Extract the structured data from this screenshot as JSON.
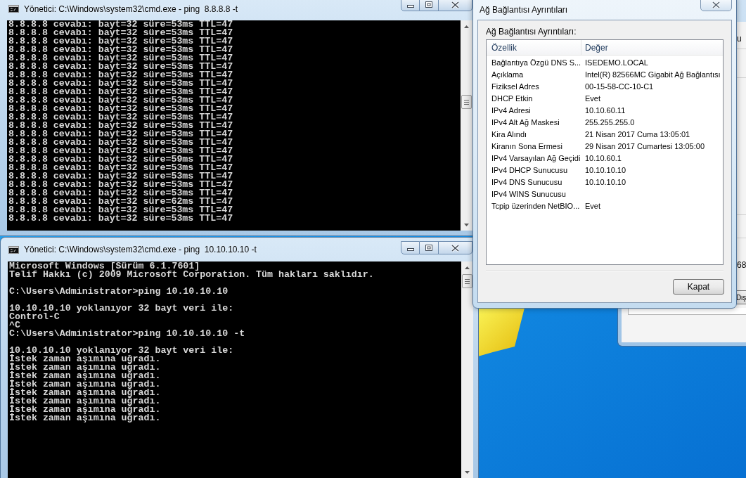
{
  "consoles": [
    {
      "title": "Yönetici: C:\\Windows\\system32\\cmd.exe - ping  8.8.8.8 -t",
      "blocks": [
        [
          "8.8.8.8 cevabı: bayt=32 süre=53ms TTL=47",
          "8.8.8.8 cevabı: bayt=32 süre=53ms TTL=47",
          "8.8.8.8 cevabı: bayt=32 süre=53ms TTL=47",
          "8.8.8.8 cevabı: bayt=32 süre=53ms TTL=47",
          "8.8.8.8 cevabı: bayt=32 süre=53ms TTL=47",
          "8.8.8.8 cevabı: bayt=32 süre=53ms TTL=47",
          "8.8.8.8 cevabı: bayt=32 süre=53ms TTL=47",
          "8.8.8.8 cevabı: bayt=32 süre=53ms TTL=47",
          "8.8.8.8 cevabı: bayt=32 süre=53ms TTL=47",
          "8.8.8.8 cevabı: bayt=32 süre=53ms TTL=47",
          "8.8.8.8 cevabı: bayt=32 süre=53ms TTL=47",
          "8.8.8.8 cevabı: bayt=32 süre=53ms TTL=47",
          "8.8.8.8 cevabı: bayt=32 süre=53ms TTL=47",
          "8.8.8.8 cevabı: bayt=32 süre=53ms TTL=47",
          "8.8.8.8 cevabı: bayt=32 süre=53ms TTL=47",
          "8.8.8.8 cevabı: bayt=32 süre=53ms TTL=47",
          "8.8.8.8 cevabı: bayt=32 süre=59ms TTL=47",
          "8.8.8.8 cevabı: bayt=32 süre=53ms TTL=47",
          "8.8.8.8 cevabı: bayt=32 süre=53ms TTL=47",
          "8.8.8.8 cevabı: bayt=32 süre=53ms TTL=47",
          "8.8.8.8 cevabı: bayt=32 süre=53ms TTL=47",
          "8.8.8.8 cevabı: bayt=32 süre=62ms TTL=47",
          "8.8.8.8 cevabı: bayt=32 süre=53ms TTL=47",
          "8.8.8.8 cevabı: bayt=32 süre=53ms TTL=47"
        ]
      ]
    },
    {
      "title": "Yönetici: C:\\Windows\\system32\\cmd.exe - ping  10.10.10.10 -t",
      "blocks": [
        [
          "Microsoft Windows [Sürüm 6.1.7601]",
          "Telif Hakkı (c) 2009 Microsoft Corporation. Tüm hakları saklıdır."
        ],
        [
          "C:\\Users\\Administrator>ping 10.10.10.10"
        ],
        [
          "10.10.10.10 yoklanıyor 32 bayt veri ile:",
          "Control-C",
          "^C",
          "C:\\Users\\Administrator>ping 10.10.10.10 -t"
        ],
        [
          "10.10.10.10 yoklanıyor 32 bayt veri ile:",
          "İstek zaman aşımına uğradı.",
          "İstek zaman aşımına uğradı.",
          "İstek zaman aşımına uğradı.",
          "İstek zaman aşımına uğradı.",
          "İstek zaman aşımına uğradı.",
          "İstek zaman aşımına uğradı.",
          "İstek zaman aşımına uğradı.",
          "İstek zaman aşımına uğradı."
        ]
      ]
    }
  ],
  "details_dialog": {
    "title": "Ağ Bağlantısı Ayrıntıları",
    "label": "Ağ Bağlantısı Ayrıntıları:",
    "columns": [
      "Özellik",
      "Değer"
    ],
    "rows": [
      {
        "property": "Bağlantıya Özgü DNS S...",
        "value": "ISEDEMO.LOCAL"
      },
      {
        "property": "Açıklama",
        "value": "Intel(R) 82566MC Gigabit Ağ Bağlantısı"
      },
      {
        "property": "Fiziksel Adres",
        "value": "00-15-58-CC-10-C1"
      },
      {
        "property": "DHCP Etkin",
        "value": "Evet"
      },
      {
        "property": "IPv4 Adresi",
        "value": "10.10.60.11"
      },
      {
        "property": "IPv4 Alt Ağ Maskesi",
        "value": "255.255.255.0"
      },
      {
        "property": "Kira Alındı",
        "value": "21 Nisan 2017 Cuma 13:05:01"
      },
      {
        "property": "Kiranın Sona Ermesi",
        "value": "29 Nisan 2017 Cumartesi 13:05:00"
      },
      {
        "property": "IPv4 Varsayılan Ağ Geçidi",
        "value": "10.10.60.1"
      },
      {
        "property": "IPv4 DHCP Sunucusu",
        "value": "10.10.10.10"
      },
      {
        "property": "IPv4 DNS Sunucusu",
        "value": "10.10.10.10"
      },
      {
        "property": "IPv4 WINS Sunucusu"
      },
      {
        "property": "Tcpip üzerinden NetBIO...",
        "value": "Evet"
      }
    ],
    "button": "Kapat"
  },
  "background_window": {
    "fragments": [
      "u",
      "68"
    ],
    "button": "Dış"
  }
}
